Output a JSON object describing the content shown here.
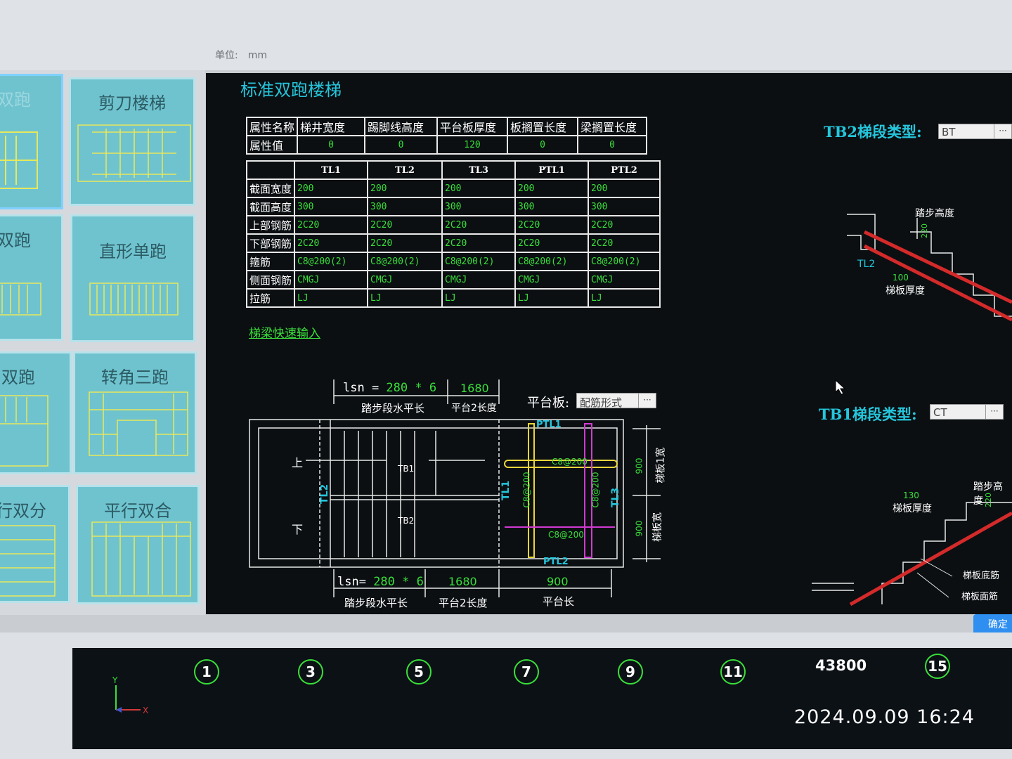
{
  "toolbar": {
    "unit_label": "单位:",
    "unit_value": "mm"
  },
  "tiles": [
    {
      "label": "双跑",
      "selected": true
    },
    {
      "label": "剪刀楼梯"
    },
    {
      "label": "双跑"
    },
    {
      "label": "直形单跑"
    },
    {
      "label": "双跑"
    },
    {
      "label": "转角三跑"
    },
    {
      "label": "行双分"
    },
    {
      "label": "平行双合"
    }
  ],
  "dialog": {
    "title": "标准双跑楼梯",
    "props": {
      "header_label": "属性名称",
      "value_label": "属性值",
      "columns": [
        "梯井宽度",
        "踢脚线高度",
        "平台板厚度",
        "板搁置长度",
        "梁搁置长度"
      ],
      "values": [
        "0",
        "0",
        "120",
        "0",
        "0"
      ]
    },
    "beams": {
      "columns": [
        "TL1",
        "TL2",
        "TL3",
        "PTL1",
        "PTL2"
      ],
      "rows": [
        {
          "label": "截面宽度",
          "values": [
            "200",
            "200",
            "200",
            "200",
            "200"
          ]
        },
        {
          "label": "截面高度",
          "values": [
            "300",
            "300",
            "300",
            "300",
            "300"
          ]
        },
        {
          "label": "上部钢筋",
          "values": [
            "2C20",
            "2C20",
            "2C20",
            "2C20",
            "2C20"
          ]
        },
        {
          "label": "下部钢筋",
          "values": [
            "2C20",
            "2C20",
            "2C20",
            "2C20",
            "2C20"
          ]
        },
        {
          "label": "箍筋",
          "values": [
            "C8@200(2)",
            "C8@200(2)",
            "C8@200(2)",
            "C8@200(2)",
            "C8@200(2)"
          ]
        },
        {
          "label": "侧面钢筋",
          "values": [
            "CMGJ",
            "CMGJ",
            "CMGJ",
            "CMGJ",
            "CMGJ"
          ]
        },
        {
          "label": "拉筋",
          "values": [
            "LJ",
            "LJ",
            "LJ",
            "LJ",
            "LJ"
          ]
        }
      ]
    },
    "quick_input_link": "梯梁快速输入",
    "platform_label": "平台板:",
    "platform_value": "配筋形式",
    "tb2_label": "TB2梯段类型:",
    "tb2_value": "BT",
    "tb1_label": "TB1梯段类型:",
    "tb1_value": "CT",
    "ok_label": "确定",
    "plan": {
      "top_lsn_prefix": "lsn = ",
      "top_lsn_value": "280 * 6",
      "top_platform_len": "1680",
      "top_tread_label": "踏步段水平长",
      "top_platform_label": "平台2长度",
      "up_label": "上",
      "down_label": "下",
      "tb1": "TB1",
      "tb2": "TB2",
      "tl1": "TL1",
      "tl2": "TL2",
      "tl3": "TL3",
      "ptl1": "PTL1",
      "ptl2": "PTL2",
      "rebar_top": "C8@200",
      "rebar_bottom": "C8@200",
      "rebar_left": "C8@200",
      "rebar_right": "C8@200",
      "width1_value": "900",
      "width1_label": "梯板1宽",
      "width2_value": "900",
      "width2_label": "梯板宽",
      "bot_lsn_prefix": "lsn= ",
      "bot_lsn_value": "280 * 6",
      "bot_platform_len": "1680",
      "bot_platform2_len": "900",
      "bot_tread_label": "踏步段水平长",
      "bot_platform_label": "平台2长度",
      "bot_platform2_label": "平台长"
    },
    "sec2": {
      "step_height_label": "踏步高度",
      "step_height_value": "220",
      "beam_label": "TL2",
      "thickness_value": "100",
      "thickness_label": "梯板厚度"
    },
    "sec1": {
      "step_height_label": "踏步高度",
      "step_height_value": "220",
      "thickness_value": "130",
      "thickness_label": "梯板厚度",
      "bottom_rebar": "梯板底筋",
      "top_rebar": "梯板面筋"
    }
  },
  "axis": {
    "numbers": [
      "1",
      "3",
      "5",
      "7",
      "9",
      "11",
      "15"
    ],
    "dimension": "43800"
  },
  "photo_timestamp": "2024.09.09   16:24"
}
